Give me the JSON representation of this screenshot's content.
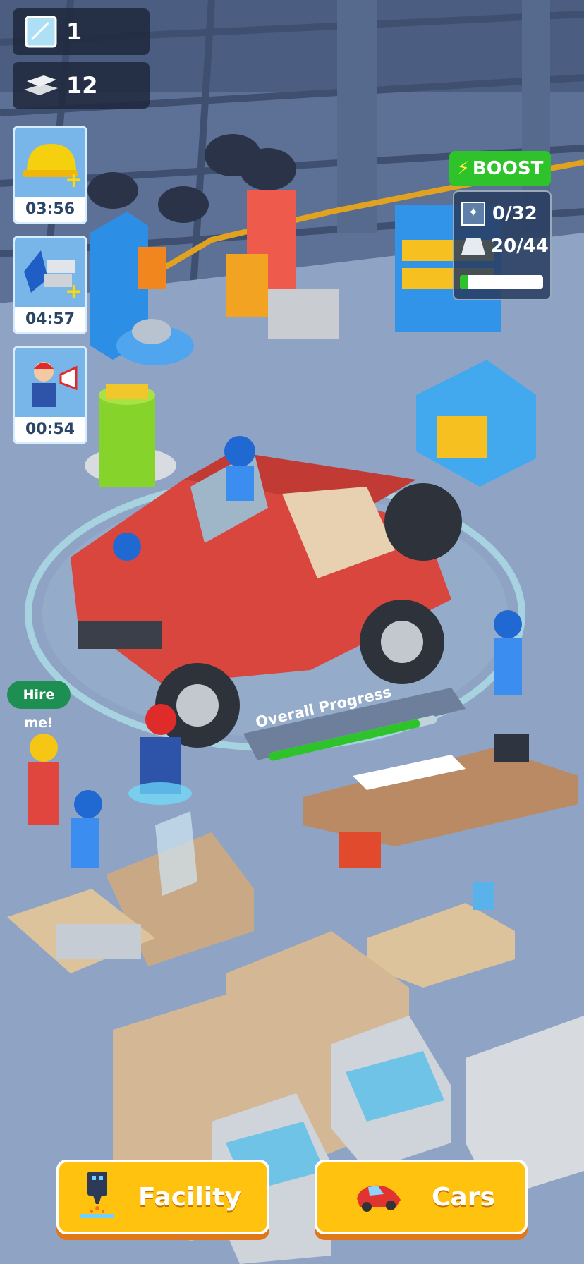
{
  "resources": {
    "glass": {
      "icon": "glass-pane-icon",
      "count": "1"
    },
    "silver": {
      "icon": "silver-ingots-icon",
      "count": "12"
    }
  },
  "boosters": [
    {
      "icon": "hard-hat-plus-icon",
      "timer": "03:56"
    },
    {
      "icon": "materials-plus-icon",
      "timer": "04:57"
    },
    {
      "icon": "manager-megaphone-icon",
      "timer": "00:54"
    }
  ],
  "boost": {
    "label": "BOOST",
    "icon": "lightning-icon"
  },
  "station_stats": {
    "glass": "0/32",
    "silver": "20/44",
    "progress": 0.1
  },
  "hire_bubble": "Hire me!",
  "overall_progress": {
    "label": "Overall Progress",
    "value": 0.9
  },
  "bottom_buttons": {
    "facility": {
      "label": "Facility",
      "icon": "machine-icon"
    },
    "cars": {
      "label": "Cars",
      "icon": "red-car-icon"
    }
  },
  "colors": {
    "boost_green": "#2ec22b",
    "button_yellow": "#ffc20e",
    "car_red": "#d9463e"
  }
}
